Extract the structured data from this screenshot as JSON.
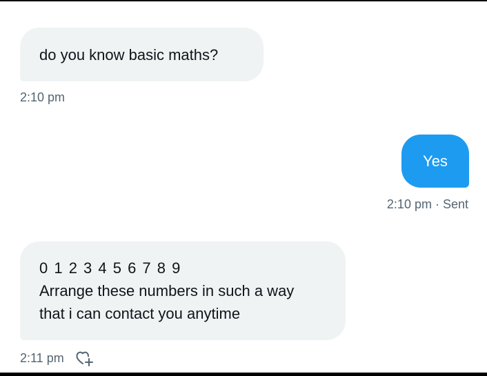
{
  "messages": [
    {
      "direction": "received",
      "text": "do you know basic maths?",
      "time": "2:10 pm"
    },
    {
      "direction": "sent",
      "text": "Yes",
      "meta": "2:10 pm · Sent"
    },
    {
      "direction": "received",
      "lines": [
        "0 1 2 3 4 5 6 7 8 9",
        "Arrange these numbers in such a way",
        "that i can contact you anytime"
      ],
      "time": "2:11 pm",
      "reaction_icon": "add-reaction-heart-icon"
    }
  ],
  "colors": {
    "received_bubble": "#eff3f4",
    "sent_bubble": "#1d9bf0",
    "text_primary": "#0f1419",
    "text_secondary": "#536471"
  }
}
